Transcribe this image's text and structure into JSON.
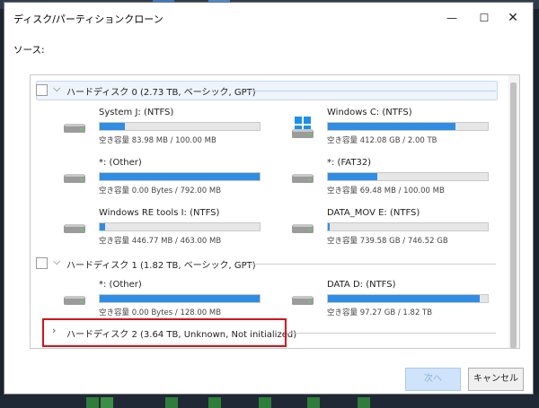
{
  "window": {
    "title": "ディスク/パーティションクローン",
    "minimize": "—",
    "maximize": "☐",
    "close": "✕"
  },
  "source_label": "ソース:",
  "disks": [
    {
      "label": "ハードディスク 0 (2.73 TB, ベーシック, GPT)",
      "expanded": true,
      "partitions": [
        {
          "name": "System J: (NTFS)",
          "free": "空き容量 83.98 MB / 100.00 MB",
          "used_fraction": 0.16,
          "icon": "drive-icon"
        },
        {
          "name": "Windows C: (NTFS)",
          "free": "空き容量 412.08 GB / 2.00 TB",
          "used_fraction": 0.8,
          "icon": "windows-icon"
        },
        {
          "name": "*: (Other)",
          "free": "空き容量 0.00 Bytes / 792.00 MB",
          "used_fraction": 1.0,
          "icon": "drive-icon"
        },
        {
          "name": "*: (FAT32)",
          "free": "空き容量 69.48 MB / 100.00 MB",
          "used_fraction": 0.31,
          "icon": "drive-icon"
        },
        {
          "name": "Windows RE tools I: (NTFS)",
          "free": "空き容量 446.77 MB / 463.00 MB",
          "used_fraction": 0.035,
          "icon": "drive-icon"
        },
        {
          "name": "DATA_MOV E: (NTFS)",
          "free": "空き容量 739.58 GB / 746.52 GB",
          "used_fraction": 0.01,
          "icon": "drive-icon"
        }
      ]
    },
    {
      "label": "ハードディスク 1 (1.82 TB, ベーシック, GPT)",
      "expanded": true,
      "partitions": [
        {
          "name": "*: (Other)",
          "free": "空き容量 0.00 Bytes / 128.00 MB",
          "used_fraction": 1.0,
          "icon": "drive-icon"
        },
        {
          "name": "DATA D: (NTFS)",
          "free": "空き容量 97.27 GB / 1.82 TB",
          "used_fraction": 0.95,
          "icon": "drive-icon"
        }
      ]
    },
    {
      "label": "ハードディスク 2 (3.64 TB, Unknown, Not initialized)",
      "expanded": false,
      "partitions": []
    }
  ],
  "buttons": {
    "next": "次へ",
    "cancel": "キャンセル"
  },
  "colors": {
    "bar_fill": "#2f8de4",
    "highlight_box": "#d9111a",
    "next_disabled": "#cfe3fb"
  }
}
